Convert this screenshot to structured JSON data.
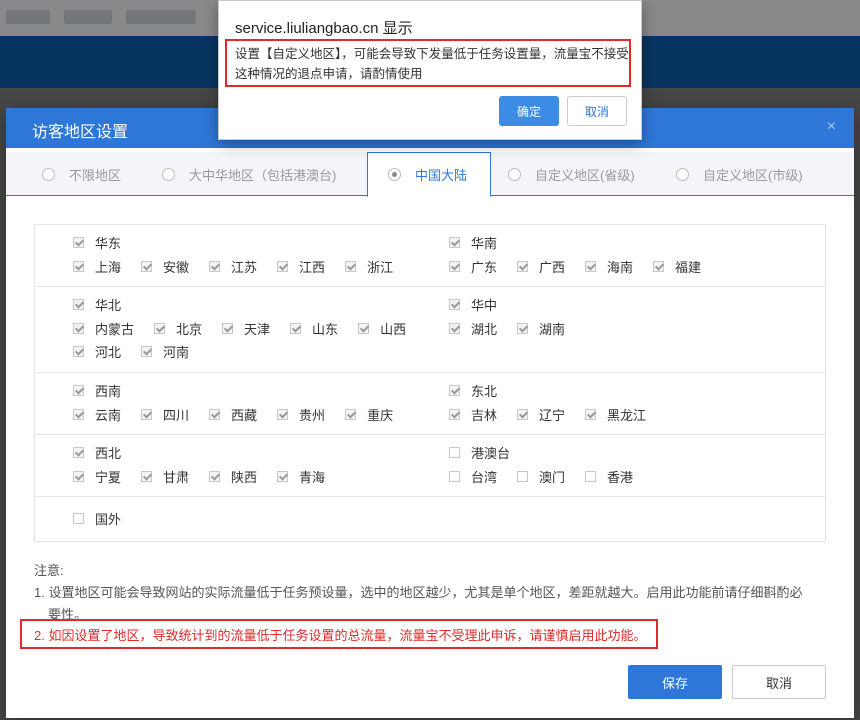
{
  "alert": {
    "title": "service.liuliangbao.cn 显示",
    "line1": "设置【自定义地区】，可能会导致下发量低于任务设置量，流量宝不接受",
    "line2": "这种情况的退点申请，请酌情使用",
    "ok": "确定",
    "cancel": "取消"
  },
  "dialog": {
    "title": "访客地区设置",
    "close": "×",
    "tabs": [
      "不限地区",
      "大中华地区（包括港澳台)",
      "中国大陆",
      "自定义地区(省级)",
      "自定义地区(市级)"
    ],
    "active_tab": "中国大陆",
    "sections": [
      {
        "left": {
          "name": "华东",
          "checked": true,
          "rows": [
            [
              "上海",
              "安徽",
              "江苏",
              "江西",
              "浙江"
            ]
          ]
        },
        "right": {
          "name": "华南",
          "checked": true,
          "rows": [
            [
              "广东",
              "广西",
              "海南",
              "福建"
            ]
          ]
        }
      },
      {
        "left": {
          "name": "华北",
          "checked": true,
          "rows": [
            [
              "内蒙古",
              "北京",
              "天津",
              "山东",
              "山西"
            ],
            [
              "河北",
              "河南"
            ]
          ]
        },
        "right": {
          "name": "华中",
          "checked": true,
          "rows": [
            [
              "湖北",
              "湖南"
            ]
          ]
        }
      },
      {
        "left": {
          "name": "西南",
          "checked": true,
          "rows": [
            [
              "云南",
              "四川",
              "西藏",
              "贵州",
              "重庆"
            ]
          ]
        },
        "right": {
          "name": "东北",
          "checked": true,
          "rows": [
            [
              "吉林",
              "辽宁",
              "黑龙江"
            ]
          ]
        }
      },
      {
        "left": {
          "name": "西北",
          "checked": true,
          "rows": [
            [
              "宁夏",
              "甘肃",
              "陕西",
              "青海"
            ]
          ]
        },
        "right": {
          "name": "港澳台",
          "checked": false,
          "rows": [
            [
              "台湾",
              "澳门",
              "香港"
            ]
          ]
        }
      },
      {
        "left": {
          "name": "国外",
          "checked": false,
          "rows": []
        }
      }
    ],
    "notes": {
      "heading": "注意:",
      "item1_a": "1. 设置地区可能会导致网站的实际流量低于任务预设量，选中的地区越少，尤其是单个地区，差距就越大。启用此功能前请仔细斟酌必",
      "item1_b": "要性。",
      "item2": "2. 如因设置了地区，导致统计到的流量低于任务设置的总流量，流量宝不受理此申诉，请谨慎启用此功能。"
    },
    "save": "保存",
    "cancel": "取消"
  }
}
